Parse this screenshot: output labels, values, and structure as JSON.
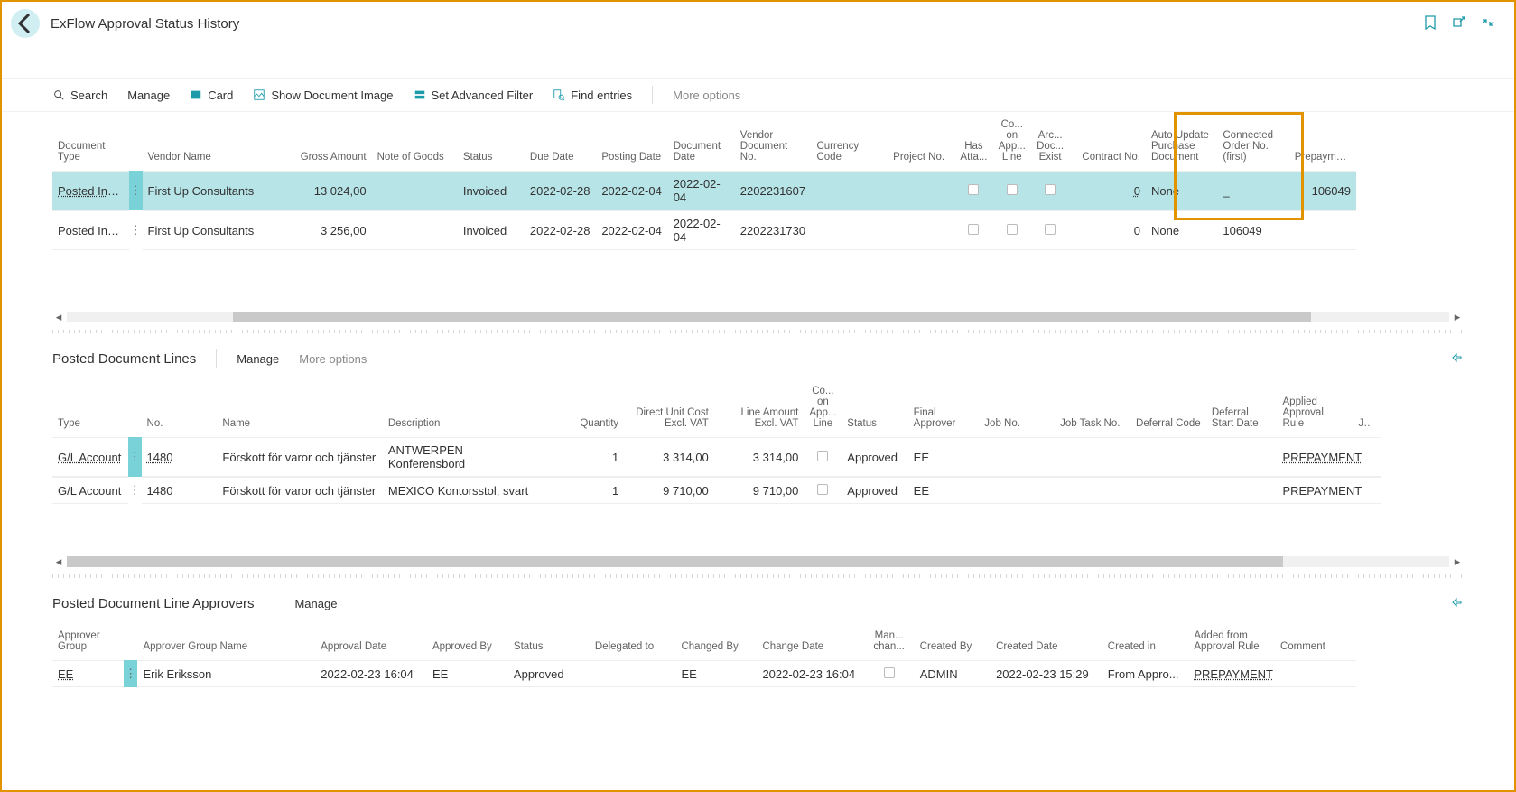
{
  "page_title": "ExFlow Approval Status History",
  "toolbar": {
    "search": "Search",
    "manage": "Manage",
    "card": "Card",
    "show_img": "Show Document Image",
    "adv_filter": "Set Advanced Filter",
    "find": "Find entries",
    "more": "More options"
  },
  "main_headers": {
    "doc_type": "Document Type",
    "vendor": "Vendor Name",
    "gross": "Gross Amount",
    "notes": "Note of Goods",
    "status": "Status",
    "due": "Due Date",
    "posting": "Posting Date",
    "doc_date": "Document Date",
    "vendor_doc": "Vendor Document No.",
    "currency": "Currency Code",
    "project": "Project No.",
    "has_att": "Has Atta...",
    "co_line": "Co... on App... Line",
    "arc": "Arc... Doc... Exist",
    "contract": "Contract No.",
    "auto": "Auto Update Purchase Document",
    "connected": "Connected Order No. (first)",
    "prepay": "Prepayment Order No."
  },
  "main_rows": [
    {
      "doc_type": "Posted Invo...",
      "vendor": "First Up Consultants",
      "gross": "13 024,00",
      "notes": "",
      "status": "Invoiced",
      "due": "2022-02-28",
      "posting": "2022-02-04",
      "doc_date": "2022-02-04",
      "vendor_doc": "2202231607",
      "currency": "",
      "project": "",
      "contract": "0",
      "auto": "None",
      "connected": "_",
      "prepay": "106049"
    },
    {
      "doc_type": "Posted Invo...",
      "vendor": "First Up Consultants",
      "gross": "3 256,00",
      "notes": "",
      "status": "Invoiced",
      "due": "2022-02-28",
      "posting": "2022-02-04",
      "doc_date": "2022-02-04",
      "vendor_doc": "2202231730",
      "currency": "",
      "project": "",
      "contract": "0",
      "auto": "None",
      "connected": "106049",
      "prepay": ""
    }
  ],
  "lines_title": "Posted Document Lines",
  "lines_toolbar": {
    "manage": "Manage",
    "more": "More options"
  },
  "lines_headers": {
    "type": "Type",
    "no": "No.",
    "name": "Name",
    "desc": "Description",
    "qty": "Quantity",
    "unit": "Direct Unit Cost Excl. VAT",
    "amount": "Line Amount Excl. VAT",
    "co": "Co... on App... Line",
    "status": "Status",
    "final": "Final Approver",
    "job": "Job No.",
    "task": "Job Task No.",
    "deferral": "Deferral Code",
    "start": "Deferral Start Date",
    "rule": "Applied Approval Rule",
    "jobtype": "Job Typ"
  },
  "lines_rows": [
    {
      "type": "G/L Account",
      "no": "1480",
      "name": "Förskott för varor och tjänster",
      "desc": "ANTWERPEN Konferensbord",
      "qty": "1",
      "unit": "3 314,00",
      "amount": "3 314,00",
      "status": "Approved",
      "final": "EE",
      "rule": "PREPAYMENT"
    },
    {
      "type": "G/L Account",
      "no": "1480",
      "name": "Förskott för varor och tjänster",
      "desc": "MEXICO Kontorsstol, svart",
      "qty": "1",
      "unit": "9 710,00",
      "amount": "9 710,00",
      "status": "Approved",
      "final": "EE",
      "rule": "PREPAYMENT"
    }
  ],
  "appr_title": "Posted Document Line Approvers",
  "appr_toolbar": {
    "manage": "Manage"
  },
  "appr_headers": {
    "group": "Approver Group",
    "name": "Approver Group Name",
    "date": "Approval Date",
    "by": "Approved By",
    "status": "Status",
    "delegated": "Delegated to",
    "changed_by": "Changed By",
    "change_date": "Change Date",
    "man": "Man... chan...",
    "created_by": "Created By",
    "created_date": "Created Date",
    "created_in": "Created in",
    "added": "Added from Approval Rule",
    "comment": "Comment"
  },
  "appr_rows": [
    {
      "group": "EE",
      "name": "Erik Eriksson",
      "date": "2022-02-23 16:04",
      "by": "EE",
      "status": "Approved",
      "delegated": "",
      "changed_by": "EE",
      "change_date": "2022-02-23 16:04",
      "created_by": "ADMIN",
      "created_date": "2022-02-23 15:29",
      "created_in": "From Appro...",
      "added": "PREPAYMENT",
      "comment": ""
    }
  ]
}
